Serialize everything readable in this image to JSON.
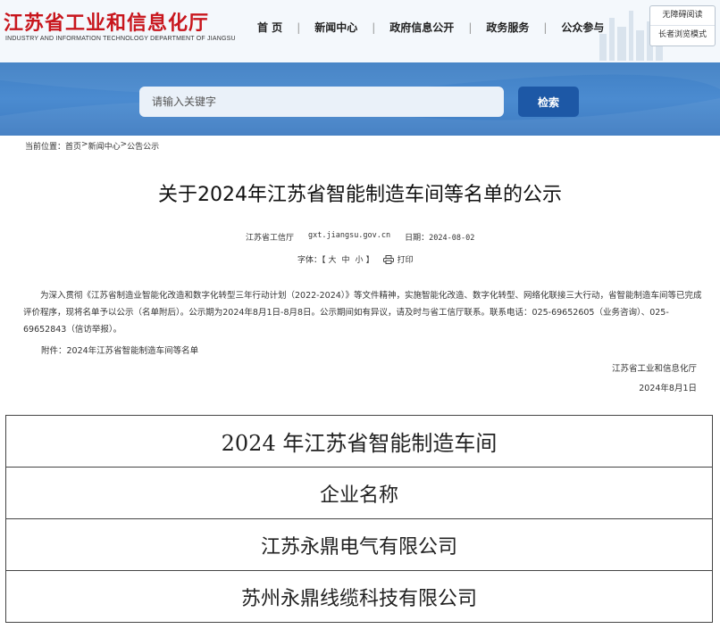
{
  "header": {
    "logo_title": "江苏省工业和信息化厅",
    "logo_subtitle": "INDUSTRY AND INFORMATION TECHNOLOGY DEPARTMENT OF JIANGSU",
    "nav": [
      {
        "label": "首 页"
      },
      {
        "label": "新闻中心"
      },
      {
        "label": "政府信息公开"
      },
      {
        "label": "政务服务"
      },
      {
        "label": "公众参与"
      }
    ],
    "nav_separator": "|",
    "accessibility": {
      "barrier_free_label": "无障碍阅读",
      "elderly_mode_label": "长者浏览模式"
    }
  },
  "search": {
    "placeholder": "请输入关键字",
    "button_label": "检索"
  },
  "breadcrumb": {
    "prefix": "当前位置：",
    "items": [
      "首页",
      "新闻中心",
      "公告公示"
    ],
    "separator": ">"
  },
  "article": {
    "title": "关于2024年江苏省智能制造车间等名单的公示",
    "source": "江苏省工信厅",
    "site": "gxt.jiangsu.gov.cn",
    "date_label": "日期：",
    "date": "2024-08-02",
    "font_size_label": "字体：【",
    "font_sizes": [
      "大",
      "中",
      "小"
    ],
    "font_size_close": "】",
    "print_label": "打印",
    "body": "为深入贯彻《江苏省制造业智能化改造和数字化转型三年行动计划（2022-2024）》等文件精神，实施智能化改造、数字化转型、网络化联接三大行动，省智能制造车间等已完成评价程序，现将名单予以公示（名单附后）。公示期为2024年8月1日-8月8日。公示期间如有异议，请及时与省工信厅联系。联系电话：025-69652605（业务咨询）、025-69652843（信访举报）。",
    "attachment": "附件：2024年江苏省智能制造车间等名单",
    "signature_org": "江苏省工业和信息化厅",
    "signature_date": "2024年8月1日"
  },
  "table": {
    "caption": "2024 年江苏省智能制造车间",
    "header": "企业名称",
    "rows": [
      "江苏永鼎电气有限公司",
      "苏州永鼎线缆科技有限公司"
    ]
  },
  "colors": {
    "brand_red": "#c8161d",
    "banner_blue": "#4b8bd0",
    "button_blue": "#1d58a6"
  }
}
